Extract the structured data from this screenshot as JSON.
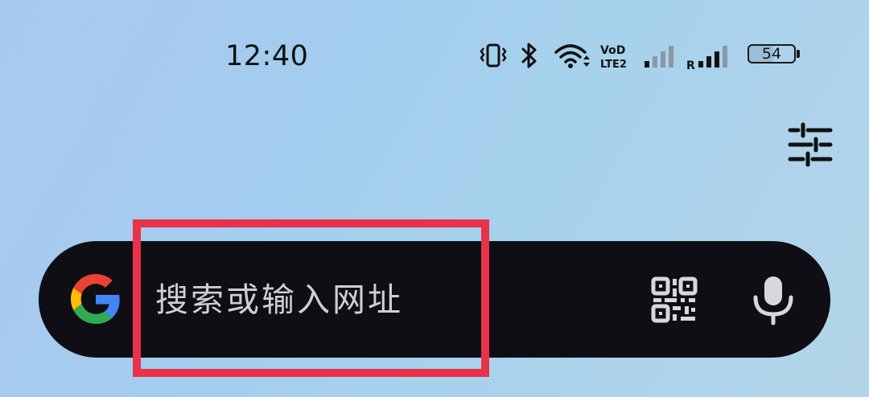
{
  "status_bar": {
    "time": "12:40",
    "battery_level": "54",
    "icons": [
      "vibrate-icon",
      "bluetooth-icon",
      "wifi-icon",
      "volte-lte2-icon",
      "signal-sim1-icon",
      "signal-sim2-roaming-icon",
      "battery-icon"
    ],
    "volte_label_top": "VoD",
    "volte_label_bottom": "LTE2",
    "roaming_label": "R"
  },
  "header": {
    "settings_icon": "sliders-icon"
  },
  "search": {
    "placeholder": "搜索或输入网址",
    "left_icon": "google-g-icon",
    "right_icons": [
      "qr-code-icon",
      "microphone-icon"
    ]
  },
  "colors": {
    "search_bar_bg": "#0f0e15",
    "highlight_border": "#e8324a",
    "google_blue": "#4285F4",
    "google_red": "#EA4335",
    "google_yellow": "#FBBC05",
    "google_green": "#34A853"
  }
}
